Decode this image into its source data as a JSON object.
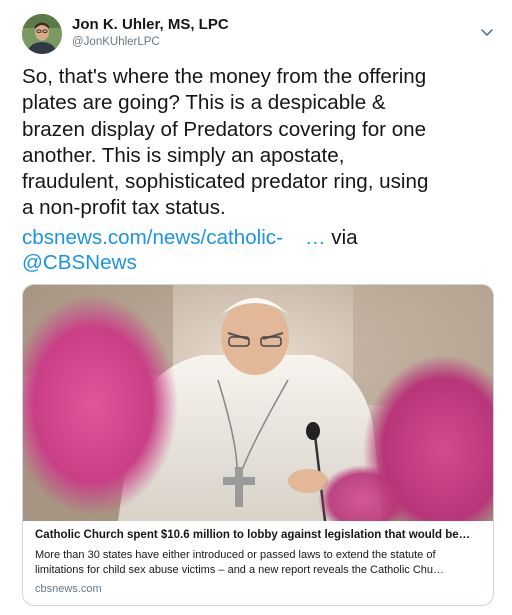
{
  "author": {
    "name": "Jon K. Uhler, MS, LPC",
    "handle": "@JonKUhlerLPC",
    "avatar_icon": "profile-photo"
  },
  "menu_icon": "chevron-down-icon",
  "tweet": {
    "lines": [
      "So, that's where the money from the offering",
      "plates are going? This is a despicable &",
      "brazen display of Predators covering for one",
      "another. This is simply an apostate,",
      "fraudulent, sophisticated predator ring, using",
      "a non-profit tax status."
    ],
    "link_text": "cbsnews.com/news/catholic-",
    "link_ellipsis": "…",
    "via_label": "via",
    "mention": "@CBSNews"
  },
  "card": {
    "image_description_icon": "news-photo",
    "title": "Catholic Church spent $10.6 million to lobby against legislation that would be…",
    "description_lines": [
      "More than 30 states have either introduced or passed laws to extend the statute of",
      "limitations for child sex abuse victims – and a new report reveals the Catholic Chu…"
    ],
    "domain": "cbsnews.com"
  },
  "colors": {
    "link": "#1b95e0",
    "text": "#14171a",
    "secondary": "#657786",
    "border": "#ccd6dd"
  }
}
